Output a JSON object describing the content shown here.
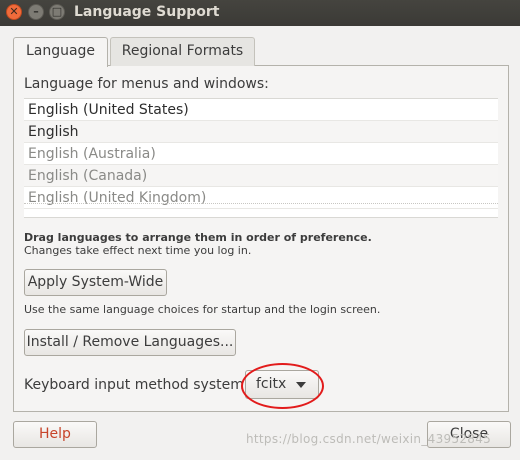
{
  "window": {
    "title": "Language Support",
    "controls": {
      "close": "✕",
      "minimize": "–",
      "maximize": "□"
    }
  },
  "tabs": [
    {
      "label": "Language",
      "active": true
    },
    {
      "label": "Regional Formats",
      "active": false
    }
  ],
  "language_section": {
    "label": "Language for menus and windows:",
    "languages": [
      {
        "name": "English (United States)",
        "enabled": true
      },
      {
        "name": "English",
        "enabled": true
      },
      {
        "name": "English (Australia)",
        "enabled": false
      },
      {
        "name": "English (Canada)",
        "enabled": false
      },
      {
        "name": "English (United Kingdom)",
        "enabled": false
      }
    ],
    "hint_bold": "Drag languages to arrange them in order of preference.",
    "hint": "Changes take effect next time you log in."
  },
  "apply_button": "Apply System-Wide",
  "apply_description": "Use the same language choices for startup and the login screen.",
  "install_button": "Install / Remove Languages...",
  "keyboard": {
    "label": "Keyboard input method system:",
    "selected": "fcitx"
  },
  "help_button": "Help",
  "close_button": "Close",
  "watermark": "https://blog.csdn.net/weixin_43952845",
  "colors": {
    "titlebar": "#3b3a36",
    "close_button": "#f06b3b",
    "help_text": "#c7442a",
    "highlight_ellipse": "#e21b1b"
  }
}
